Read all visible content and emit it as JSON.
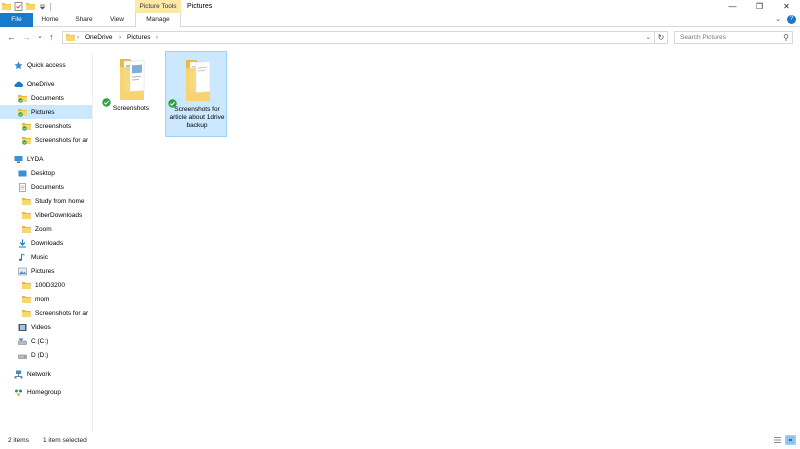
{
  "window": {
    "title": "Pictures",
    "context_tab_group": "Picture Tools",
    "controls": {
      "minimize": "—",
      "maximize": "❐",
      "close": "✕"
    }
  },
  "ribbon": {
    "tabs": [
      "File",
      "Home",
      "Share",
      "View",
      "Manage"
    ],
    "expand_icon": "⌄",
    "help_label": "?"
  },
  "address": {
    "back": "←",
    "forward": "→",
    "recent": "⌄",
    "up": "↑",
    "crumbs": [
      "OneDrive",
      "Pictures"
    ],
    "separator": "›",
    "dropdown": "⌄",
    "refresh": "↻",
    "search_placeholder": "Search Pictures",
    "search_icon": "⚲"
  },
  "nav": {
    "items": [
      {
        "label": "Quick access",
        "icon": "star-icon",
        "indent": 0
      },
      {
        "label": "OneDrive",
        "icon": "cloud-icon",
        "indent": 0
      },
      {
        "label": "Documents",
        "icon": "folder-synced-icon",
        "indent": 1
      },
      {
        "label": "Pictures",
        "icon": "folder-synced-icon",
        "indent": 1,
        "selected": true
      },
      {
        "label": "Screenshots",
        "icon": "folder-synced-icon",
        "indent": 2
      },
      {
        "label": "Screenshots for ar",
        "icon": "folder-synced-icon",
        "indent": 2
      },
      {
        "label": "LYDA",
        "icon": "computer-icon",
        "indent": 0
      },
      {
        "label": "Desktop",
        "icon": "desktop-icon",
        "indent": 1
      },
      {
        "label": "Documents",
        "icon": "documents-icon",
        "indent": 1
      },
      {
        "label": "Study from home",
        "icon": "folder-icon",
        "indent": 2
      },
      {
        "label": "ViberDownloads",
        "icon": "folder-icon",
        "indent": 2
      },
      {
        "label": "Zoom",
        "icon": "folder-icon",
        "indent": 2
      },
      {
        "label": "Downloads",
        "icon": "download-icon",
        "indent": 1
      },
      {
        "label": "Music",
        "icon": "music-icon",
        "indent": 1
      },
      {
        "label": "Pictures",
        "icon": "pictures-icon",
        "indent": 1
      },
      {
        "label": "100D3200",
        "icon": "folder-icon",
        "indent": 2
      },
      {
        "label": "mom",
        "icon": "folder-icon",
        "indent": 2
      },
      {
        "label": "Screenshots for ar",
        "icon": "folder-icon",
        "indent": 2
      },
      {
        "label": "Videos",
        "icon": "videos-icon",
        "indent": 1
      },
      {
        "label": "C (C:)",
        "icon": "drive-c-icon",
        "indent": 1
      },
      {
        "label": "D (D:)",
        "icon": "drive-d-icon",
        "indent": 1
      },
      {
        "label": "Network",
        "icon": "network-icon",
        "indent": 0
      },
      {
        "label": "Homegroup",
        "icon": "homegroup-icon",
        "indent": 0
      }
    ]
  },
  "files": [
    {
      "name": "Screenshots",
      "status": "synced",
      "selected": false
    },
    {
      "name": "Screenshots for article about 1drive backup",
      "status": "synced",
      "selected": true
    }
  ],
  "status_bar": {
    "item_count": "2 items",
    "selection": "1 item selected"
  },
  "colors": {
    "accent": "#1979ca",
    "selection": "#cce8ff",
    "selection_border": "#99d1ff",
    "folder": "#f7d674",
    "sync_ok": "#2ea043",
    "context_tab": "#fce9a8"
  }
}
